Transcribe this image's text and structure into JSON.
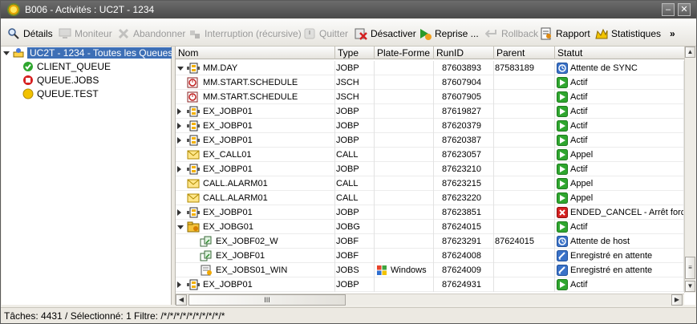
{
  "window": {
    "title": "B006 - Activités : UC2T - 1234"
  },
  "toolbar": {
    "details": "Détails",
    "monitor": "Moniteur",
    "abort": "Abandonner",
    "interrupt": "Interruption (récursive)",
    "quit": "Quitter",
    "deactivate": "Désactiver",
    "restart": "Reprise ...",
    "rollback": "Rollback",
    "report": "Rapport",
    "statistics": "Statistiques",
    "more": "»"
  },
  "tree": {
    "root": "UC2T - 1234 - Toutes les Queues",
    "items": [
      "CLIENT_QUEUE",
      "QUEUE.JOBS",
      "QUEUE.TEST"
    ]
  },
  "grid": {
    "headers": [
      "Nom",
      "Type",
      "Plate-Forme",
      "RunID",
      "Parent",
      "Statut"
    ],
    "rows": [
      {
        "name": "MM.DAY",
        "type": "JOBP",
        "platform": "",
        "runid": "87603893",
        "parent": "87583189",
        "status": "Attente de SYNC",
        "icon": "jobp",
        "status_icon": "sync",
        "expander": "open",
        "indent": 0
      },
      {
        "name": "MM.START.SCHEDULE",
        "type": "JSCH",
        "platform": "",
        "runid": "87607904",
        "parent": "",
        "status": "Actif",
        "icon": "jsch",
        "status_icon": "active",
        "expander": "none",
        "indent": 0
      },
      {
        "name": "MM.START.SCHEDULE",
        "type": "JSCH",
        "platform": "",
        "runid": "87607905",
        "parent": "",
        "status": "Actif",
        "icon": "jsch",
        "status_icon": "active",
        "expander": "none",
        "indent": 0
      },
      {
        "name": "EX_JOBP01",
        "type": "JOBP",
        "platform": "",
        "runid": "87619827",
        "parent": "",
        "status": "Actif",
        "icon": "jobp",
        "status_icon": "active",
        "expander": "closed",
        "indent": 0
      },
      {
        "name": "EX_JOBP01",
        "type": "JOBP",
        "platform": "",
        "runid": "87620379",
        "parent": "",
        "status": "Actif",
        "icon": "jobp",
        "status_icon": "active",
        "expander": "closed",
        "indent": 0
      },
      {
        "name": "EX_JOBP01",
        "type": "JOBP",
        "platform": "",
        "runid": "87620387",
        "parent": "",
        "status": "Actif",
        "icon": "jobp",
        "status_icon": "active",
        "expander": "closed",
        "indent": 0
      },
      {
        "name": "EX_CALL01",
        "type": "CALL",
        "platform": "",
        "runid": "87623057",
        "parent": "",
        "status": "Appel",
        "icon": "call",
        "status_icon": "active",
        "expander": "none",
        "indent": 0
      },
      {
        "name": "EX_JOBP01",
        "type": "JOBP",
        "platform": "",
        "runid": "87623210",
        "parent": "",
        "status": "Actif",
        "icon": "jobp",
        "status_icon": "active",
        "expander": "closed",
        "indent": 0
      },
      {
        "name": "CALL.ALARM01",
        "type": "CALL",
        "platform": "",
        "runid": "87623215",
        "parent": "",
        "status": "Appel",
        "icon": "call",
        "status_icon": "active",
        "expander": "none",
        "indent": 0
      },
      {
        "name": "CALL.ALARM01",
        "type": "CALL",
        "platform": "",
        "runid": "87623220",
        "parent": "",
        "status": "Appel",
        "icon": "call",
        "status_icon": "active",
        "expander": "none",
        "indent": 0
      },
      {
        "name": "EX_JOBP01",
        "type": "JOBP",
        "platform": "",
        "runid": "87623851",
        "parent": "",
        "status": "ENDED_CANCEL - Arrêt forcé",
        "icon": "jobp",
        "status_icon": "cancel",
        "expander": "closed",
        "indent": 0
      },
      {
        "name": "EX_JOBG01",
        "type": "JOBG",
        "platform": "",
        "runid": "87624015",
        "parent": "",
        "status": "Actif",
        "icon": "jobg",
        "status_icon": "active",
        "expander": "open",
        "indent": 0
      },
      {
        "name": "EX_JOBF02_W",
        "type": "JOBF",
        "platform": "",
        "runid": "87623291",
        "parent": "87624015",
        "status": "Attente de host",
        "icon": "jobf",
        "status_icon": "sync",
        "expander": "none",
        "indent": 1
      },
      {
        "name": "EX_JOBF01",
        "type": "JOBF",
        "platform": "",
        "runid": "87624008",
        "parent": "",
        "status": "Enregistré en attente",
        "icon": "jobf",
        "status_icon": "registered",
        "expander": "none",
        "indent": 1
      },
      {
        "name": "EX_JOBS01_WIN",
        "type": "JOBS",
        "platform": "Windows",
        "runid": "87624009",
        "parent": "",
        "status": "Enregistré en attente",
        "icon": "jobs",
        "status_icon": "registered",
        "expander": "none",
        "indent": 1
      },
      {
        "name": "EX_JOBP01",
        "type": "JOBP",
        "platform": "",
        "runid": "87624931",
        "parent": "",
        "status": "Actif",
        "icon": "jobp",
        "status_icon": "active",
        "expander": "closed",
        "indent": 0
      }
    ]
  },
  "hscroll": {
    "thumb_label": "III"
  },
  "status": {
    "tasks": "Tâches: 4431 / Sélectionné: 1",
    "filter": "Filtre: /*/*/*/*/*/*/*/*/*/*"
  }
}
